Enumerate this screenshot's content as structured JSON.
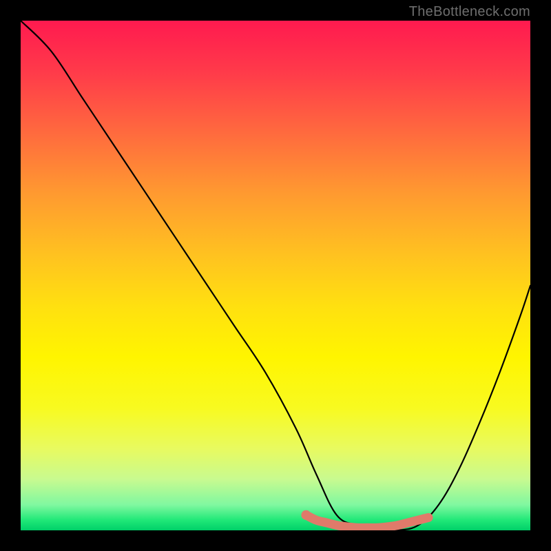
{
  "watermark": "TheBottleneck.com",
  "chart_data": {
    "type": "line",
    "title": "",
    "xlabel": "",
    "ylabel": "",
    "xlim": [
      0,
      100
    ],
    "ylim": [
      0,
      100
    ],
    "series": [
      {
        "name": "bottleneck-curve",
        "color": "#000000",
        "x": [
          0,
          6,
          12,
          18,
          24,
          30,
          36,
          42,
          48,
          54,
          58,
          62,
          66,
          70,
          74,
          78,
          82,
          86,
          90,
          94,
          98,
          100
        ],
        "values": [
          100,
          94,
          85,
          76,
          67,
          58,
          49,
          40,
          31,
          20,
          11,
          3,
          1,
          0,
          0,
          1,
          5,
          12,
          21,
          31,
          42,
          48
        ]
      },
      {
        "name": "optimal-range-highlight",
        "color": "#e07a6a",
        "x": [
          56,
          58,
          60,
          62,
          64,
          66,
          68,
          70,
          72,
          74,
          76,
          78,
          80
        ],
        "values": [
          3,
          2,
          1.5,
          1,
          0.7,
          0.5,
          0.5,
          0.5,
          0.7,
          1,
          1.5,
          2,
          2.5
        ]
      }
    ],
    "optimal_marker": {
      "x": 56,
      "y": 3
    }
  }
}
